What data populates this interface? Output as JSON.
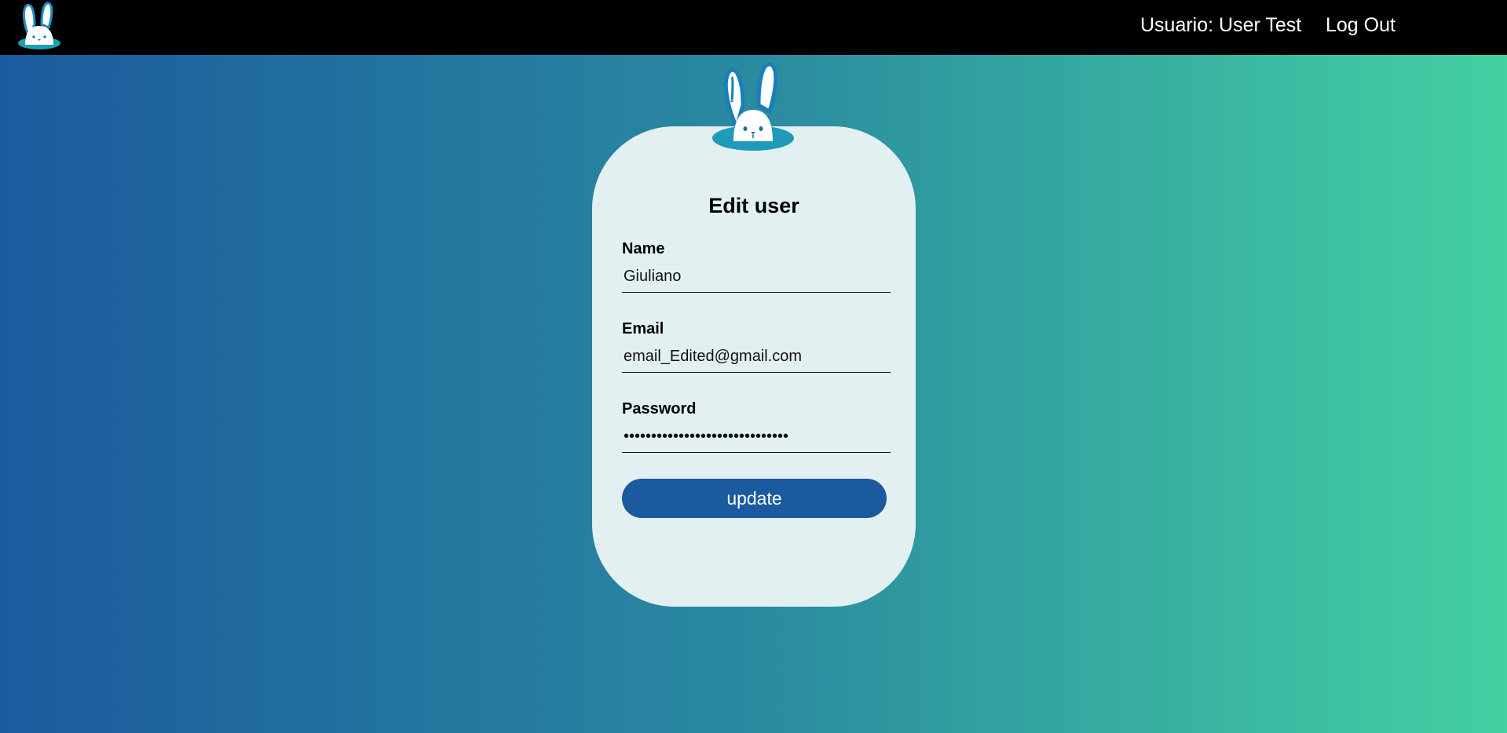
{
  "nav": {
    "user_label": "Usuario: User Test",
    "logout_label": "Log Out",
    "logo_icon": "bunny-logo-icon"
  },
  "form": {
    "title": "Edit user",
    "name_label": "Name",
    "name_value": "Giuliano",
    "email_label": "Email",
    "email_value": "email_Edited@gmail.com",
    "password_label": "Password",
    "password_value": "password12345678901234567890ab",
    "submit_label": "update"
  },
  "colors": {
    "topbar": "#000000",
    "gradient_start": "#1b5a9e",
    "gradient_end": "#44d0a2",
    "card": "#e3f0f1",
    "button": "#1b5a9e"
  }
}
